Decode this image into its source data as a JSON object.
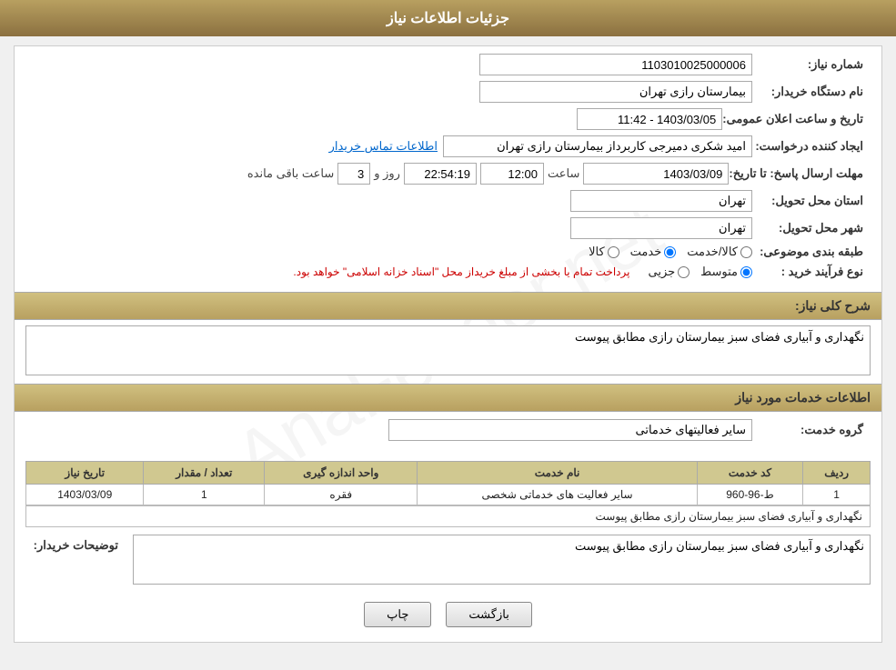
{
  "header": {
    "title": "جزئیات اطلاعات نیاز"
  },
  "fields": {
    "shomare_niaz_label": "شماره نیاز:",
    "shomare_niaz_value": "1103010025000006",
    "name_dastgah_label": "نام دستگاه خریدار:",
    "name_dastgah_value": "بیمارستان رازی تهران",
    "tarikh_label": "تاریخ و ساعت اعلان عمومی:",
    "tarikh_value": "1403/03/05 - 11:42",
    "ijad_konande_label": "ایجاد کننده درخواست:",
    "ijad_konande_value": "امید شکری دمیرجی کاربرداز بیمارستان رازی تهران",
    "ijad_konande_link": "اطلاعات تماس خریدار",
    "mohlat_label": "مهلت ارسال پاسخ: تا تاریخ:",
    "mohlat_date": "1403/03/09",
    "mohlat_saat_label": "ساعت",
    "mohlat_saat": "12:00",
    "mohlat_roz_label": "روز و",
    "mohlat_roz": "3",
    "mohlat_baqi_label": "ساعت باقی مانده",
    "mohlat_baqi": "22:54:19",
    "ostan_label": "استان محل تحویل:",
    "ostan_value": "تهران",
    "shahr_label": "شهر محل تحویل:",
    "shahr_value": "تهران",
    "tabaqe_label": "طبقه بندی موضوعی:",
    "tabaqe_kala": "کالا",
    "tabaqe_khedmat": "خدمت",
    "tabaqe_kala_khedmat": "کالا/خدمت",
    "tabaqe_selected": "خدمت",
    "noе_farayand_label": "نوع فرآیند خرید :",
    "noе_jozei": "جزیی",
    "noе_motavaset": "متوسط",
    "noе_warning": "پرداخت تمام یا بخشی از مبلغ خریداز محل \"اسناد خزانه اسلامی\" خواهد بود.",
    "sharh_label": "شرح کلی نیاز:",
    "sharh_value": "نگهداری و آبیاری فضای سبز بیمارستان رازی مطابق پیوست",
    "khedmat_label": "اطلاعات خدمات مورد نیاز",
    "goroh_label": "گروه خدمت:",
    "goroh_value": "سایر فعالیتهای خدماتی"
  },
  "table": {
    "headers": [
      "ردیف",
      "کد خدمت",
      "نام خدمت",
      "واحد اندازه گیری",
      "تعداد / مقدار",
      "تاریخ نیاز"
    ],
    "rows": [
      {
        "radif": "1",
        "kod": "ط-96-960",
        "nam": "سایر فعالیت های خدماتی شخصی",
        "vahed": "فقره",
        "tedad": "1",
        "tarikh": "1403/03/09"
      }
    ]
  },
  "tozi_label": "توضیحات خریدار:",
  "tozi_value": "نگهداری و آبیاری فضای سبز بیمارستان رازی مطابق پیوست",
  "buttons": {
    "chap": "چاپ",
    "bazgasht": "بازگشت"
  }
}
